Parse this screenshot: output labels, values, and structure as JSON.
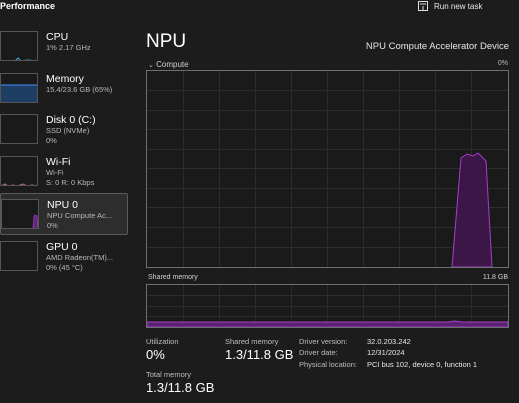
{
  "header": {
    "title": "Performance",
    "run_task_label": "Run new task"
  },
  "sidebar": {
    "items": [
      {
        "name": "CPU",
        "sub1": "1% 2.17 GHz",
        "sub2": ""
      },
      {
        "name": "Memory",
        "sub1": "15.4/23.6 GB (65%)",
        "sub2": ""
      },
      {
        "name": "Disk 0 (C:)",
        "sub1": "SSD (NVMe)",
        "sub2": "0%"
      },
      {
        "name": "Wi-Fi",
        "sub1": "Wi-Fi",
        "sub2": "S: 0 R: 0 Kbps"
      },
      {
        "name": "NPU 0",
        "sub1": "NPU Compute Ac...",
        "sub2": "0%"
      },
      {
        "name": "GPU 0",
        "sub1": "AMD Radeon(TM)...",
        "sub2": "0% (45 °C)"
      }
    ]
  },
  "main": {
    "title": "NPU",
    "device_name": "NPU Compute Accelerator Device",
    "compute": {
      "label": "Compute",
      "max_label": "0%"
    },
    "shared_memory_graph": {
      "label": "Shared memory",
      "max_label": "11.8 GB"
    },
    "stats": {
      "utilization_label": "Utilization",
      "utilization_value": "0%",
      "shared_memory_label": "Shared memory",
      "shared_memory_value": "1.3/11.8 GB",
      "total_memory_label": "Total memory",
      "total_memory_value": "1.3/11.8 GB"
    },
    "info": {
      "driver_version_key": "Driver version:",
      "driver_version": "32.0.203.242",
      "driver_date_key": "Driver date:",
      "driver_date": "12/31/2024",
      "physical_location_key": "Physical location:",
      "physical_location": "PCI bus 102, device 0, function 1"
    }
  },
  "colors": {
    "cpu": "#4aa3d8",
    "memory": "#3c7bd6",
    "disk": "#7cc050",
    "wifi": "#c8689a",
    "npu": "#a23fc8",
    "gpu": "#8fa7bd"
  }
}
